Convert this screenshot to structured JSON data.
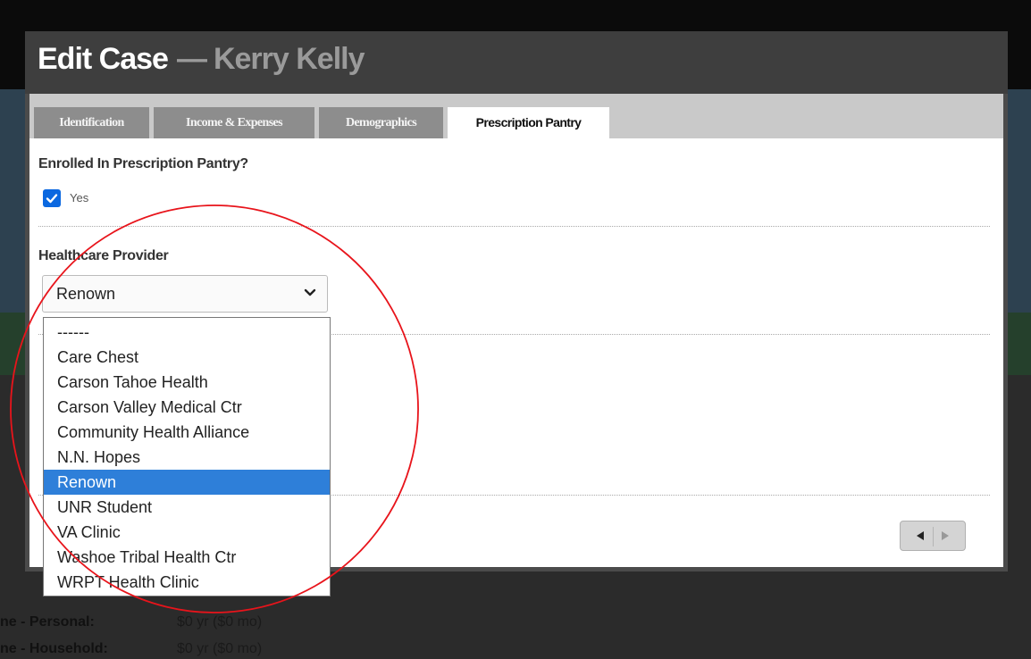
{
  "modal": {
    "title": "Edit Case",
    "separator": "—",
    "subject": "Kerry Kelly"
  },
  "tabs": [
    {
      "label": "Identification",
      "active": false
    },
    {
      "label": "Income & Expenses",
      "active": false
    },
    {
      "label": "Demographics",
      "active": false
    },
    {
      "label": "Prescription Pantry",
      "active": true
    }
  ],
  "form": {
    "enrolled_question": "Enrolled In Prescription Pantry?",
    "enrolled_option": "Yes",
    "enrolled_checked": true,
    "provider_label": "Healthcare Provider",
    "provider_value": "Renown"
  },
  "provider_options": [
    "------",
    "Care Chest",
    "Carson Tahoe Health",
    "Carson Valley Medical Ctr",
    "Community Health Alliance",
    "N.N. Hopes",
    "Renown",
    "UNR Student",
    "VA Clinic",
    "Washoe Tribal Health Ctr",
    "WRPT Health Clinic"
  ],
  "background_rows": [
    {
      "label": "ne - Personal:",
      "value": "$0 yr ($0 mo)"
    },
    {
      "label": "ne - Household:",
      "value": "$0 yr ($0 mo)"
    }
  ],
  "colors": {
    "accent": "#2e7fd9",
    "checkbox": "#0b68e0",
    "annotation": "#e8141b"
  },
  "icons": {
    "checkbox": "checkmark-icon",
    "select": "chevron-down-icon",
    "prev": "triangle-left-icon",
    "next": "triangle-right-icon"
  }
}
